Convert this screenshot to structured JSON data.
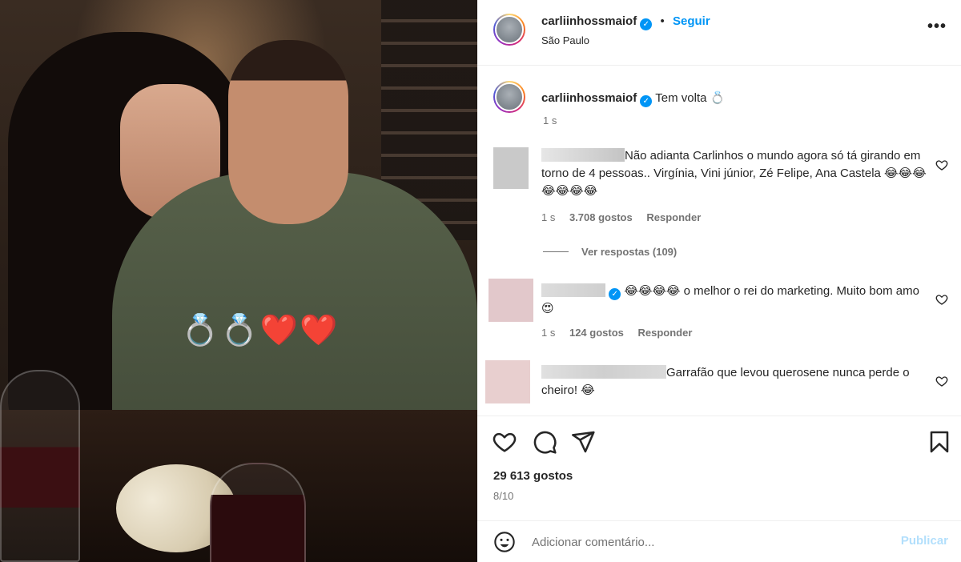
{
  "post": {
    "username": "carliinhossmaiof",
    "follow_label": "Seguir",
    "dot": "•",
    "location": "São Paulo",
    "more_label": "•••",
    "verified_mark": "✓",
    "photo_stickers": "💍💍❤️❤️"
  },
  "caption": {
    "username": "carliinhossmaiof",
    "text": "Tem volta 💍",
    "time": "1 s"
  },
  "comments": [
    {
      "username": "",
      "text": "Não adianta Carlinhos o mundo agora só tá girando em torno de 4 pessoas.. Virgínia, Vini júnior, Zé Felipe, Ana Castela 😂😂😂😂😂😂😂",
      "time": "1 s",
      "likes": "3.708 gostos",
      "reply": "Responder",
      "view_replies": "Ver respostas (109)"
    },
    {
      "username": "",
      "text": "😂😂😂😂 o melhor o rei do marketing. Muito bom amo 😍",
      "time": "1 s",
      "likes": "124 gostos",
      "reply": "Responder"
    },
    {
      "username": "",
      "text": "Garrafão que levou querosene nunca perde o cheiro! 😂",
      "time": "",
      "likes": "",
      "reply": ""
    }
  ],
  "actions": {
    "likes_total": "29 613 gostos",
    "slide_counter": "8/10"
  },
  "add_comment": {
    "placeholder": "Adicionar comentário...",
    "publish_label": "Publicar"
  },
  "icons": {
    "like": "heart-icon",
    "comment": "comment-icon",
    "share": "send-icon",
    "save": "bookmark-icon",
    "emoji": "emoji-icon",
    "more": "more-icon",
    "verified": "verified-badge-icon"
  },
  "colors": {
    "link_blue": "#0095f6",
    "publish_disabled": "#b2dffc",
    "muted_text": "#737373",
    "divider": "#efefef"
  }
}
